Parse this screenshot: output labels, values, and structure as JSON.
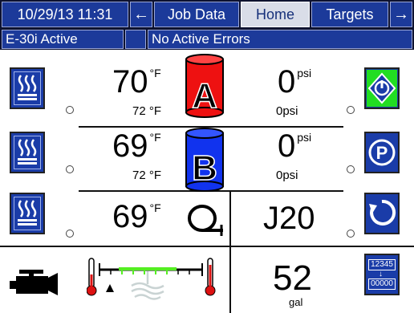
{
  "header": {
    "datetime": "10/29/13 11:31",
    "left_arrow": "←",
    "tabs": [
      {
        "label": "Job Data",
        "selected": false
      },
      {
        "label": "Home",
        "selected": true
      },
      {
        "label": "Targets",
        "selected": false
      }
    ],
    "right_arrow": "→",
    "machine_status": "E-30i Active",
    "error_status": "No Active Errors"
  },
  "home": {
    "row_a": {
      "temp_actual": "70",
      "temp_unit": "°F",
      "temp_setpoint": "72 °F",
      "drum_letter": "A",
      "drum_color": "#ee1111",
      "pressure_actual": "0",
      "pressure_unit": "psi",
      "pressure_setpoint": "0psi",
      "right_button_icon": "start-diamond-icon",
      "right_button_color": "#22dd22"
    },
    "row_b": {
      "temp_actual": "69",
      "temp_unit": "°F",
      "temp_setpoint": "72 °F",
      "drum_letter": "B",
      "drum_color": "#1133ee",
      "pressure_actual": "0",
      "pressure_unit": "psi",
      "pressure_setpoint": "0psi",
      "right_button_icon": "park-icon"
    },
    "row_hose": {
      "temp_actual": "69",
      "temp_unit": "°F",
      "hose_icon": "hose-icon",
      "mix_chamber": "J20",
      "right_button_icon": "cycle-arrow-icon"
    },
    "bottom": {
      "engine_icon": "engine-icon",
      "gauge_icon": "temperature-range-gauge-icon",
      "gauge_level": 0.5,
      "counter_value": "52",
      "counter_unit": "gal",
      "counter_reset_labels": [
        "12345",
        "00000"
      ]
    }
  },
  "colors": {
    "header_blue": "#1c3a9a",
    "button_blue": "#1a3ca8",
    "selected_tab": "#d9dde8"
  }
}
